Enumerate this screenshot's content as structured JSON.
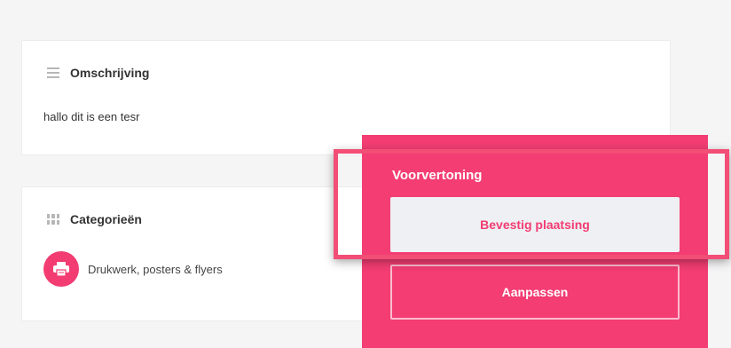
{
  "description_card": {
    "title": "Omschrijving",
    "text": "hallo dit is een tesr",
    "icon": "list-icon"
  },
  "categories_card": {
    "title": "Categorieën",
    "icon": "grid-icon",
    "items": [
      {
        "label": "Drukwerk, posters & flyers",
        "icon": "printer-icon"
      }
    ]
  },
  "preview_panel": {
    "title": "Voorvertoning",
    "confirm_label": "Bevestig plaatsing",
    "edit_label": "Aanpassen"
  },
  "colors": {
    "accent": "#f33d73",
    "background": "#f5f5f6",
    "card": "#ffffff"
  }
}
